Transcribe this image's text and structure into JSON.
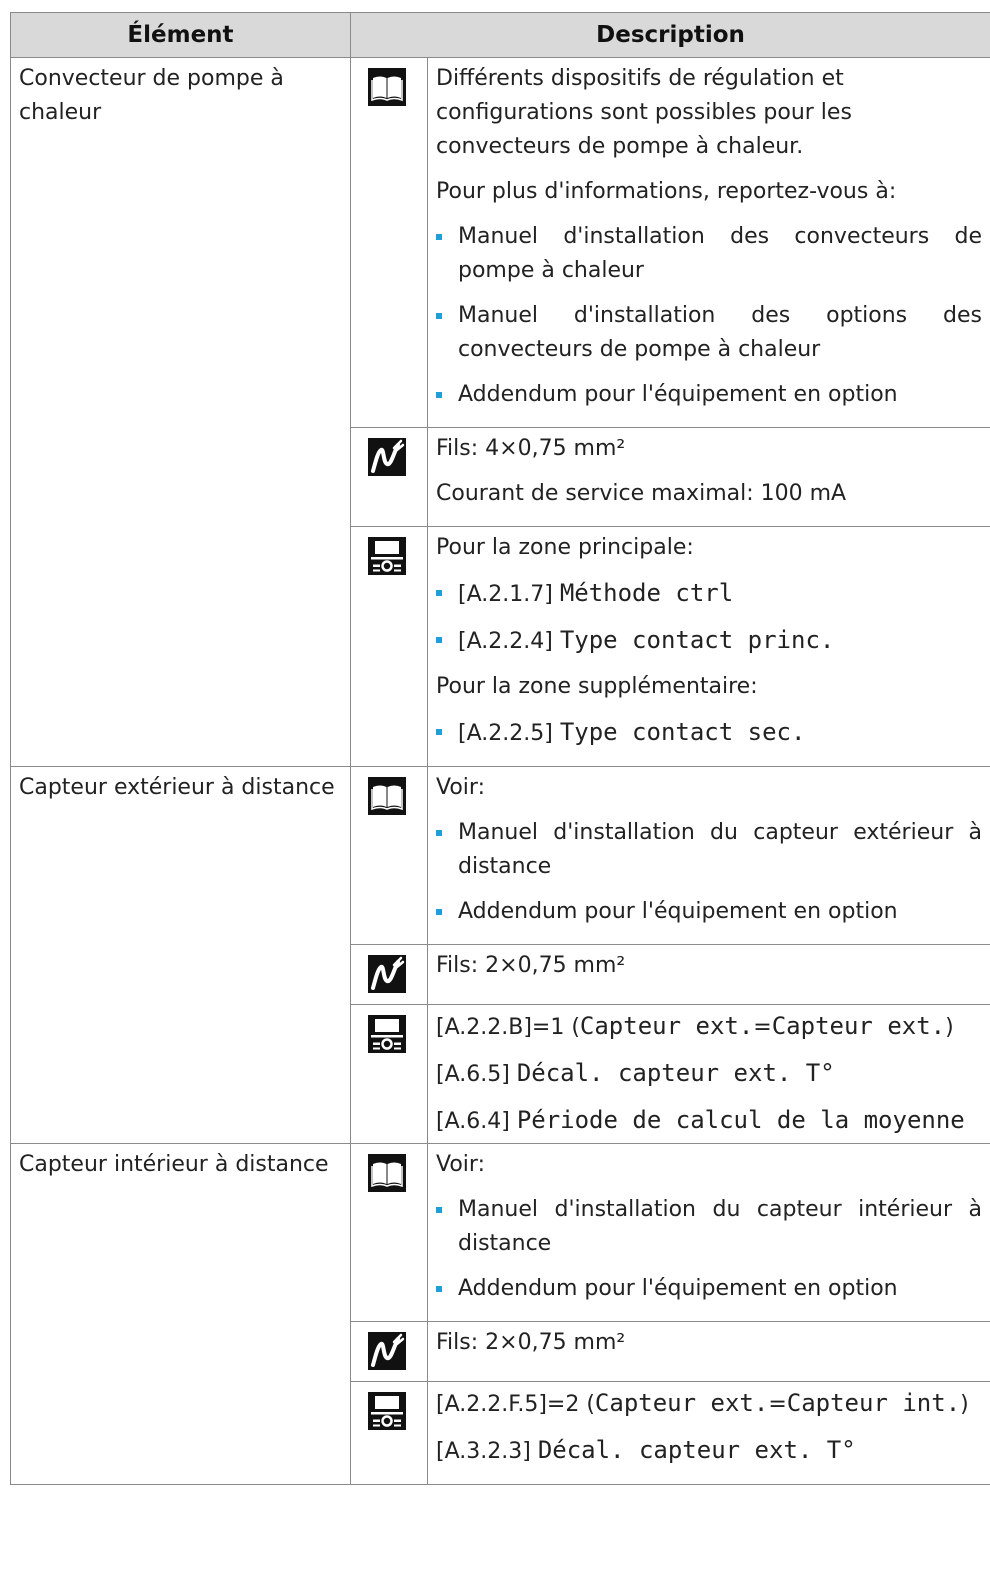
{
  "header": {
    "element": "Élément",
    "description": "Description"
  },
  "rows": [
    {
      "element": "Convecteur de pompe à chaleur",
      "book": {
        "lines": [
          "Différents dispositifs de régulation et configurations sont possibles pour les convecteurs de pompe à chaleur.",
          "Pour plus d'informations, reportez-vous à:"
        ],
        "bullets": [
          "Manuel d'installation des convecteurs de pompe à chaleur",
          "Manuel d'installation des options des convecteurs de pompe à chaleur",
          "Addendum pour l'équipement en option"
        ]
      },
      "wire": {
        "lines": [
          "Fils: 4×0,75 mm²",
          "Courant de service maximal: 100 mA"
        ]
      },
      "ui": {
        "intro": "Pour la zone principale:",
        "b1_code": "[A.2.1.7]",
        "b1_text": "Méthode ctrl",
        "b2_code": "[A.2.2.4]",
        "b2_text": "Type contact princ.",
        "intro2": "Pour la zone supplémentaire:",
        "b3_code": "[A.2.2.5]",
        "b3_text": "Type contact sec."
      }
    },
    {
      "element": "Capteur extérieur à distance",
      "book": {
        "lines": [
          "Voir:"
        ],
        "bullets": [
          "Manuel d'installation du capteur extérieur à distance",
          "Addendum pour l'équipement en option"
        ]
      },
      "wire": {
        "lines": [
          "Fils: 2×0,75 mm²"
        ]
      },
      "ui": {
        "l1_code": "[A.2.2.B]=1 (",
        "l1_m1": "Capteur ext.",
        "l1_eq": "=",
        "l1_m2": "Capteur ext.",
        "l1_end": ")",
        "l2_code": "[A.6.5]",
        "l2_text": "Décal. capteur ext. T°",
        "l3_code": "[A.6.4]",
        "l3_text": "Période de calcul de la moyenne"
      }
    },
    {
      "element": "Capteur intérieur à distance",
      "book": {
        "lines": [
          "Voir:"
        ],
        "bullets": [
          "Manuel d'installation du capteur intérieur à distance",
          "Addendum pour l'équipement en option"
        ]
      },
      "wire": {
        "lines": [
          "Fils: 2×0,75 mm²"
        ]
      },
      "ui": {
        "l1_code": "[A.2.2.F.5]=2 (",
        "l1_m1": "Capteur ext.",
        "l1_eq": "=",
        "l1_m2": "Capteur int.",
        "l1_end": ")",
        "l2_code": "[A.3.2.3]",
        "l2_text": "Décal. capteur ext. T°"
      }
    }
  ]
}
